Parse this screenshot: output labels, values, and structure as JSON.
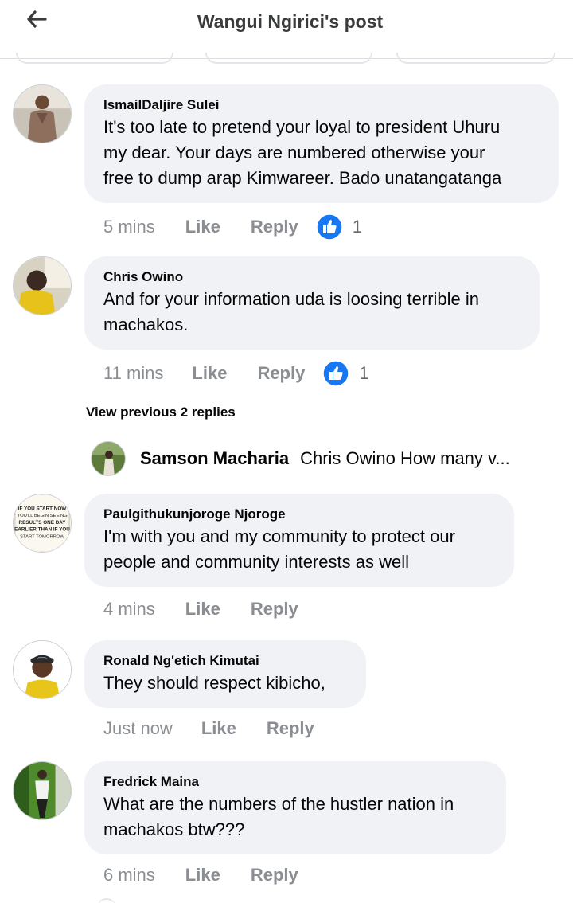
{
  "header": {
    "title": "Wangui Ngirici's post",
    "back_icon": "back-arrow-icon"
  },
  "comments": [
    {
      "author": "IsmailDaljire Sulei",
      "lines": [
        "It's too late to pretend your loyal to president Uhuru",
        "my dear. Your days are numbered otherwise your",
        "free to dump arap Kimwareer. Bado unatangatanga"
      ],
      "time": "5 mins",
      "like": "Like",
      "reply": "Reply",
      "likes": "1"
    },
    {
      "author": "Chris Owino",
      "lines": [
        "And for your information uda is loosing terrible in",
        "machakos."
      ],
      "time": "11 mins",
      "like": "Like",
      "reply": "Reply",
      "likes": "1"
    },
    {
      "author": "Paulgithukunjoroge Njoroge",
      "lines": [
        "I'm with you and my community to protect our",
        "people and community interests as well"
      ],
      "time": "4 mins",
      "like": "Like",
      "reply": "Reply",
      "avatar_text": [
        "IF YOU START NOW",
        "YOU'LL BEGIN SEEING",
        "RESULTS ONE DAY",
        "EARLIER THAN IF YOU",
        "START TOMORROW"
      ]
    },
    {
      "author": "Ronald Ng'etich Kimutai",
      "lines": [
        "They should respect kibicho,"
      ],
      "time": "Just now",
      "like": "Like",
      "reply": "Reply"
    },
    {
      "author": "Fredrick Maina",
      "lines": [
        "What are the numbers of the hustler nation in",
        "machakos btw???"
      ],
      "time": "6 mins",
      "like": "Like",
      "reply": "Reply"
    }
  ],
  "replies": {
    "view_previous": "View previous 2 replies",
    "preview_author": "Samson Macharia",
    "preview_text": "Chris Owino How many v..."
  },
  "colors": {
    "like_blue": "#1877f2",
    "bubble": "#f0f2f5",
    "meta": "#8a8d91"
  }
}
